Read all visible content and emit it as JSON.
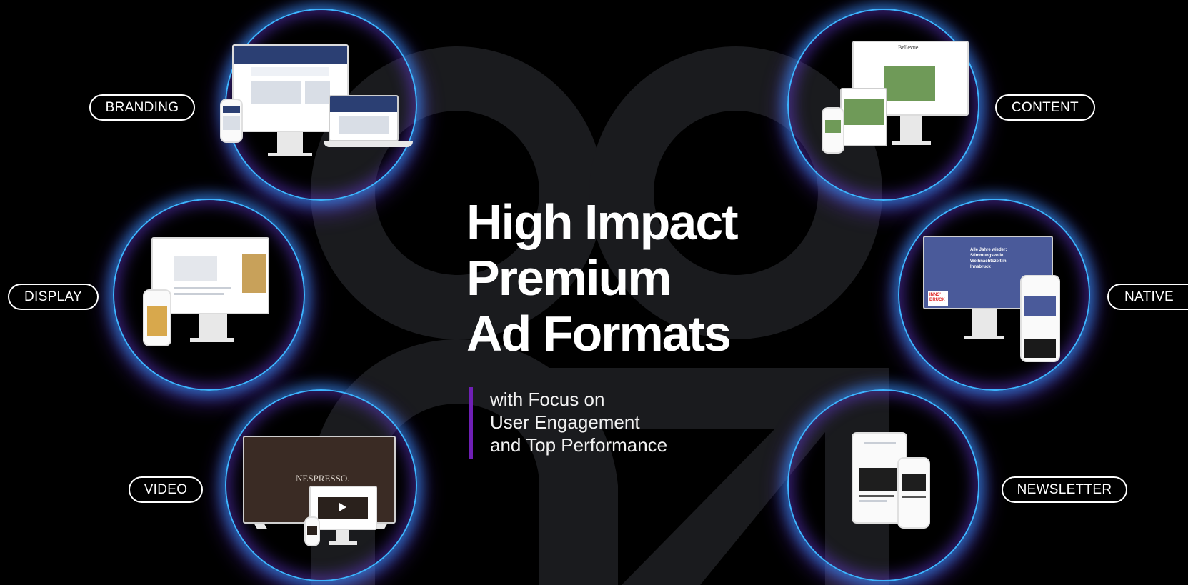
{
  "headline": {
    "line1": "High Impact",
    "line2": "Premium",
    "line3": "Ad Formats"
  },
  "subheadline": {
    "line1": "with Focus on",
    "line2": "User Engagement",
    "line3": "and Top Performance"
  },
  "formats": {
    "branding": "BRANDING",
    "display": "DISPLAY",
    "video": "VIDEO",
    "content": "CONTENT",
    "native": "NATIVE",
    "newsletter": "NEWSLETTER"
  },
  "mockups": {
    "video_brand": "NESPRESSO.",
    "native_badge": "INNS' BRUCK",
    "native_headline": "Alle Jahre wieder: Stimmungsvolle Weihnachtszeit in Innsbruck",
    "content_brand": "Bellevue"
  },
  "colors": {
    "background": "#000000",
    "ring_outer": "#3db3ff",
    "ring_glow": "#7a3cff",
    "accent_bar": "#6f1fb5",
    "text": "#ffffff"
  }
}
